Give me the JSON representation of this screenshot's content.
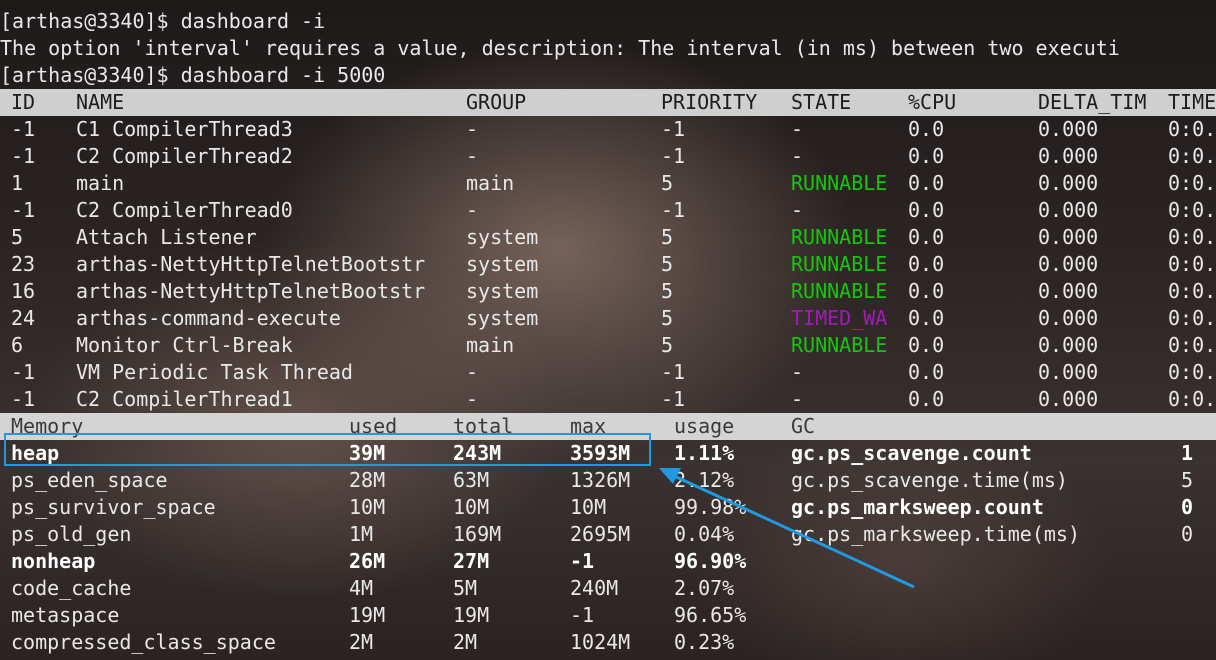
{
  "terminal": {
    "lines": [
      "[arthas@3340]$ dashboard -i",
      "The option 'interval' requires a value, description: The interval (in ms) between two executi",
      "[arthas@3340]$ dashboard -i 5000"
    ]
  },
  "thread_table": {
    "headers": [
      "ID",
      "NAME",
      "GROUP",
      "PRIORITY",
      "STATE",
      "%CPU",
      "DELTA_TIM",
      "TIME"
    ],
    "rows": [
      {
        "id": "-1",
        "name": "C1 CompilerThread3",
        "group": "-",
        "priority": "-1",
        "state": "-",
        "cpu": "0.0",
        "delta": "0.000",
        "time": "0:0."
      },
      {
        "id": "-1",
        "name": "C2 CompilerThread2",
        "group": "-",
        "priority": "-1",
        "state": "-",
        "cpu": "0.0",
        "delta": "0.000",
        "time": "0:0."
      },
      {
        "id": "1",
        "name": "main",
        "group": "main",
        "priority": "5",
        "state": "RUNNABLE",
        "cpu": "0.0",
        "delta": "0.000",
        "time": "0:0."
      },
      {
        "id": "-1",
        "name": "C2 CompilerThread0",
        "group": "-",
        "priority": "-1",
        "state": "-",
        "cpu": "0.0",
        "delta": "0.000",
        "time": "0:0."
      },
      {
        "id": "5",
        "name": "Attach Listener",
        "group": "system",
        "priority": "5",
        "state": "RUNNABLE",
        "cpu": "0.0",
        "delta": "0.000",
        "time": "0:0."
      },
      {
        "id": "23",
        "name": "arthas-NettyHttpTelnetBootstr",
        "group": "system",
        "priority": "5",
        "state": "RUNNABLE",
        "cpu": "0.0",
        "delta": "0.000",
        "time": "0:0."
      },
      {
        "id": "16",
        "name": "arthas-NettyHttpTelnetBootstr",
        "group": "system",
        "priority": "5",
        "state": "RUNNABLE",
        "cpu": "0.0",
        "delta": "0.000",
        "time": "0:0."
      },
      {
        "id": "24",
        "name": "arthas-command-execute",
        "group": "system",
        "priority": "5",
        "state": "TIMED_WA",
        "cpu": "0.0",
        "delta": "0.000",
        "time": "0:0."
      },
      {
        "id": "6",
        "name": "Monitor Ctrl-Break",
        "group": "main",
        "priority": "5",
        "state": "RUNNABLE",
        "cpu": "0.0",
        "delta": "0.000",
        "time": "0:0."
      },
      {
        "id": "-1",
        "name": "VM Periodic Task Thread",
        "group": "-",
        "priority": "-1",
        "state": "-",
        "cpu": "0.0",
        "delta": "0.000",
        "time": "0:0."
      },
      {
        "id": "-1",
        "name": "C2 CompilerThread1",
        "group": "-",
        "priority": "-1",
        "state": "-",
        "cpu": "0.0",
        "delta": "0.000",
        "time": "0:0."
      }
    ]
  },
  "memory_table": {
    "headers": [
      "Memory",
      "used",
      "total",
      "max",
      "usage",
      "GC"
    ],
    "rows": [
      {
        "name": "heap",
        "used": "39M",
        "total": "243M",
        "max": "3593M",
        "usage": "1.11%"
      },
      {
        "name": "ps_eden_space",
        "used": "28M",
        "total": "63M",
        "max": "1326M",
        "usage": "2.12%"
      },
      {
        "name": "ps_survivor_space",
        "used": "10M",
        "total": "10M",
        "max": "10M",
        "usage": "99.98%"
      },
      {
        "name": "ps_old_gen",
        "used": "1M",
        "total": "169M",
        "max": "2695M",
        "usage": "0.04%"
      },
      {
        "name": "nonheap",
        "used": "26M",
        "total": "27M",
        "max": "-1",
        "usage": "96.90%"
      },
      {
        "name": "code_cache",
        "used": "4M",
        "total": "5M",
        "max": "240M",
        "usage": "2.07%"
      },
      {
        "name": "metaspace",
        "used": "19M",
        "total": "19M",
        "max": "-1",
        "usage": "96.65%"
      },
      {
        "name": "compressed_class_space",
        "used": "2M",
        "total": "2M",
        "max": "1024M",
        "usage": "0.23%"
      }
    ]
  },
  "gc_table": {
    "rows": [
      {
        "name": "gc.ps_scavenge.count",
        "value": "1"
      },
      {
        "name": "gc.ps_scavenge.time(ms)",
        "value": "5"
      },
      {
        "name": "gc.ps_marksweep.count",
        "value": "0"
      },
      {
        "name": "gc.ps_marksweep.time(ms)",
        "value": "0"
      }
    ]
  },
  "colors": {
    "runnable": "#16c60c",
    "timed_waiting": "#a11ab8",
    "highlight": "#1e9be0"
  },
  "annotation": {
    "highlighted_row": "heap",
    "arrow_icon": "arrow-pointer-icon"
  }
}
